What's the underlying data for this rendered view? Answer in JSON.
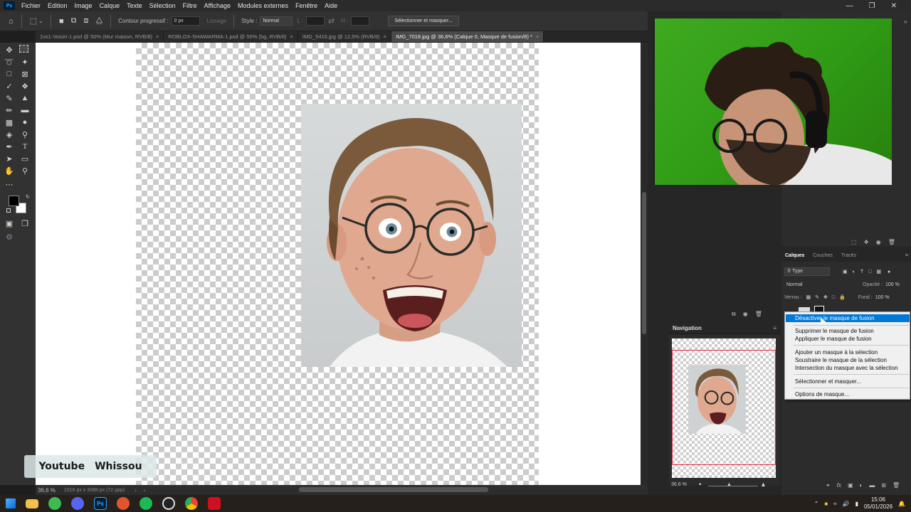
{
  "menu": {
    "app_logo": "Ps",
    "items": [
      "Fichier",
      "Edition",
      "Image",
      "Calque",
      "Texte",
      "Sélection",
      "Filtre",
      "Affichage",
      "Modules externes",
      "Fenêtre",
      "Aide"
    ]
  },
  "options_bar": {
    "contour_label": "Contour progressif :",
    "contour_value": "0 px",
    "lissage_label": "Lissage",
    "style_label": "Style :",
    "style_value": "Normal",
    "l_label": "L :",
    "h_label": "H :",
    "select_mask_button": "Sélectionner et masquer..."
  },
  "tabs": [
    {
      "label": "1vs1-Voisin-1.psd @ 50% (Mur maison, RVB/8)"
    },
    {
      "label": "ROBLOX-SHAWARMA-1.psd @ 50% (bg, RVB/8)"
    },
    {
      "label": "IMG_5416.jpg @ 12,5% (RVB/8)"
    },
    {
      "label": "IMG_7018.jpg @ 36,6% (Calque 0, Masque de fusion/8) *"
    }
  ],
  "watermark": {
    "part1": "Youtube",
    "part2": "Whissou"
  },
  "status": {
    "zoom": "36,6 %",
    "dimensions": "2316 px x 3088 px (72 ppp)"
  },
  "navigation": {
    "title": "Navigation",
    "zoom": "36,6 %"
  },
  "layers": {
    "tabs": [
      "Calques",
      "Couches",
      "Tracés"
    ],
    "filter_kind": "Type",
    "blend_mode": "Normal",
    "opacity_label": "Opacité :",
    "opacity_value": "100 %",
    "lock_label": "Verrou :",
    "fill_label": "Fond :",
    "fill_value": "100 %"
  },
  "context_menu": {
    "items": [
      "Désactiver le masque de fusion",
      "Supprimer le masque de fusion",
      "Appliquer le masque de fusion",
      "Ajouter un masque à la sélection",
      "Soustraire le masque de la sélection",
      "Intersection du masque avec la sélection",
      "Sélectionner et masquer...",
      "Options de masque..."
    ]
  },
  "taskbar": {
    "time": "15:06",
    "date": "05/01/2026",
    "apps": [
      "Ps"
    ]
  },
  "colors": {
    "accent_highlight": "#0078d7",
    "nav_red_frame": "#e0304a",
    "greenscreen": "#3faa20"
  }
}
